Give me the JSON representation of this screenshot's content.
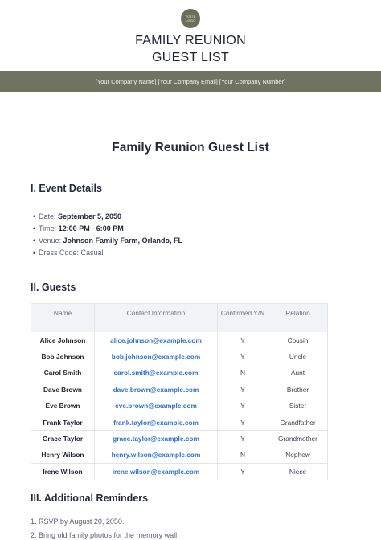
{
  "logo": {
    "line1": "YOUR",
    "line2": "LOGO"
  },
  "brand": {
    "line1": "FAMILY REUNION",
    "line2": "GUEST LIST"
  },
  "band_text": "[Your Company Name] [Your Company Email] [Your Company Number]",
  "doc_title": "Family Reunion Guest List",
  "event": {
    "heading": "I. Event Details",
    "items": [
      {
        "label": "Date: ",
        "value": "September 5, 2050"
      },
      {
        "label": "Time: ",
        "value": "12:00 PM - 6:00 PM"
      },
      {
        "label": "Venue: ",
        "value": "Johnson Family Farm, Orlando, FL"
      },
      {
        "label": "Dress Code: Casual",
        "value": ""
      }
    ]
  },
  "guests": {
    "heading": "II. Guests",
    "columns": [
      "Name",
      "Contact Information",
      "Confirmed Y/N",
      "Relation"
    ],
    "rows": [
      [
        "Alice Johnson",
        "alice.johnson@example.com",
        "Y",
        "Cousin"
      ],
      [
        "Bob Johnson",
        "bob.johnson@example.com",
        "Y",
        "Uncle"
      ],
      [
        "Carol Smith",
        "carol.smith@example.com",
        "N",
        "Aunt"
      ],
      [
        "Dave Brown",
        "dave.brown@example.com",
        "Y",
        "Brother"
      ],
      [
        "Eve Brown",
        "eve.brown@example.com",
        "Y",
        "Sister"
      ],
      [
        "Frank Taylor",
        "frank.taylor@example.com",
        "Y",
        "Grandfather"
      ],
      [
        "Grace Taylor",
        "grace.taylor@example.com",
        "Y",
        "Grandmother"
      ],
      [
        "Henry Wilson",
        "henry.wilson@example.com",
        "N",
        "Nephew"
      ],
      [
        "Irene Wilson",
        "irene.wilson@example.com",
        "Y",
        "Niece"
      ]
    ]
  },
  "reminders": {
    "heading": "III. Additional Reminders",
    "items": [
      "1. RSVP by August 20, 2050.",
      "2. Bring old family photos for the memory wall."
    ]
  }
}
